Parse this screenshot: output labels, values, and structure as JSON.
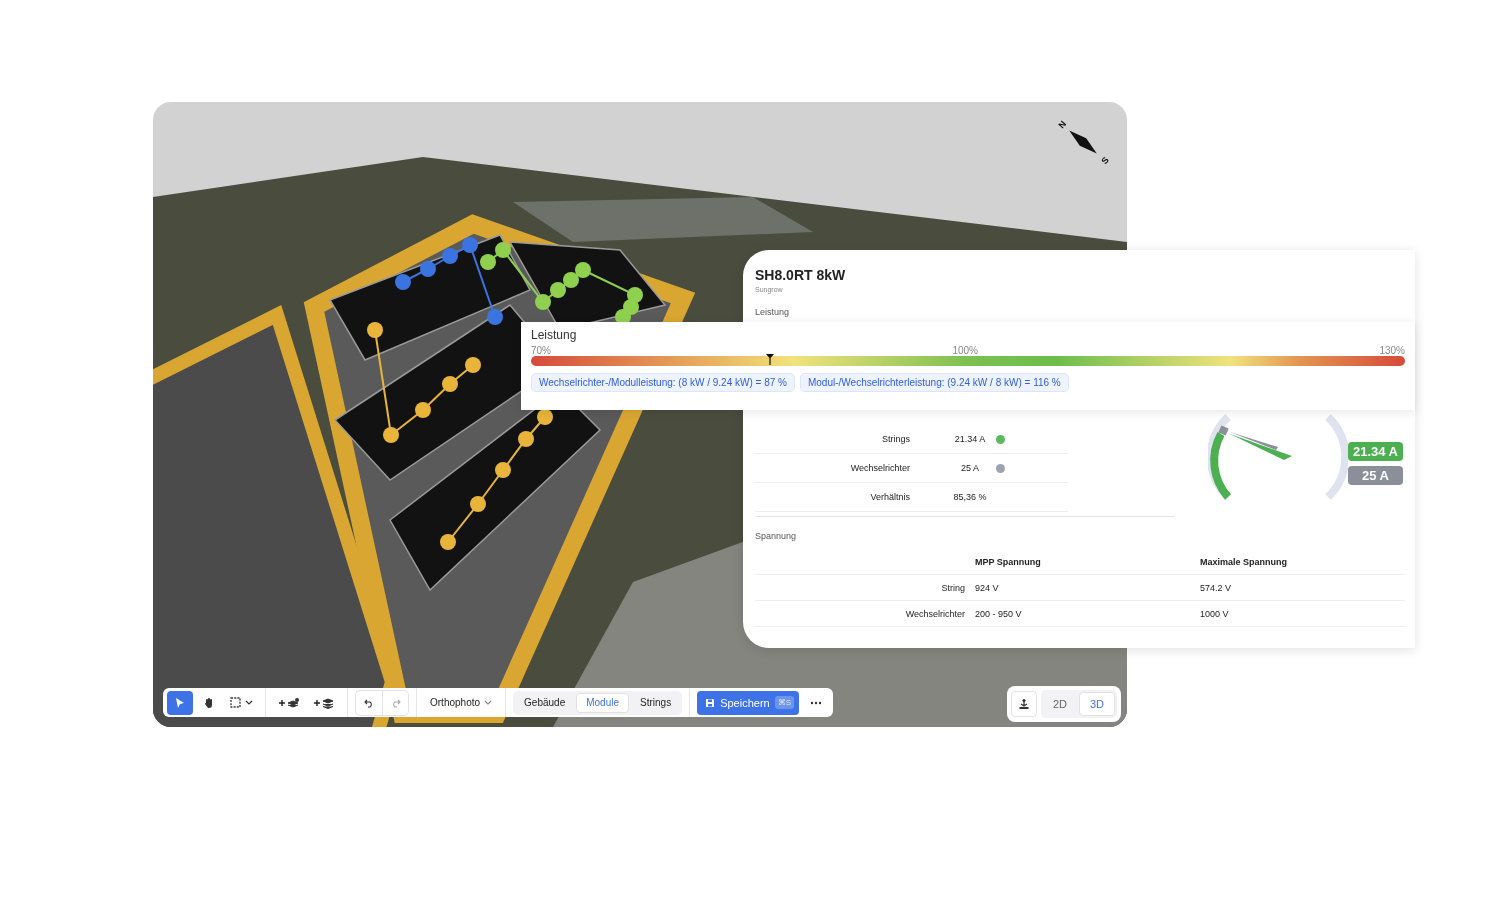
{
  "compass": {
    "north": "N",
    "south": "S"
  },
  "inverter": {
    "name": "SH8.0RT 8kW",
    "brand": "Sungrow",
    "section": "Leistung"
  },
  "power_popup": {
    "title": "Leistung",
    "scale": [
      "70%",
      "100%",
      "130%"
    ],
    "level": 0.274,
    "chips": [
      "Wechselrichter-/Modulleistung: (8 kW / 9.24 kW) = 87 %",
      "Modul-/Wechselrichterleistung: (9.24 kW / 8 kW) = 116 %"
    ]
  },
  "current": {
    "rows": [
      {
        "label": "Strings",
        "value": "21.34 A",
        "color": "#5cb85c"
      },
      {
        "label": "Wechselrichter",
        "value": "25 A",
        "color": "#9ca3af"
      },
      {
        "label": "Verhältnis",
        "value": "85,36 %"
      }
    ],
    "badges": [
      {
        "text": "21.34 A",
        "color": "#4caf50"
      },
      {
        "text": "25 A",
        "color": "#8a8f9a"
      }
    ]
  },
  "voltage": {
    "title": "Spannung",
    "columns": [
      "MPP Spannung",
      "Maximale Spannung"
    ],
    "rows": [
      {
        "label": "String",
        "values": [
          "924 V",
          "574.2 V"
        ]
      },
      {
        "label": "Wechselrichter",
        "values": [
          "200 - 950 V",
          "1000 V"
        ]
      }
    ]
  },
  "toolbar": {
    "tools": [
      {
        "kind": "select",
        "selected": true
      },
      {
        "kind": "hand",
        "selected": false
      },
      {
        "kind": "marquee",
        "selected": false
      }
    ],
    "layer_dropdown": "Orthophoto",
    "view_tabs": [
      {
        "label": "Gebäude",
        "selected": false
      },
      {
        "label": "Module",
        "selected": true
      },
      {
        "label": "Strings",
        "selected": false
      }
    ],
    "save": {
      "label": "Speichern",
      "shortcut": "⌘S"
    }
  },
  "view_modes": [
    {
      "label": "2D",
      "selected": false
    },
    {
      "label": "3D",
      "selected": true
    }
  ]
}
